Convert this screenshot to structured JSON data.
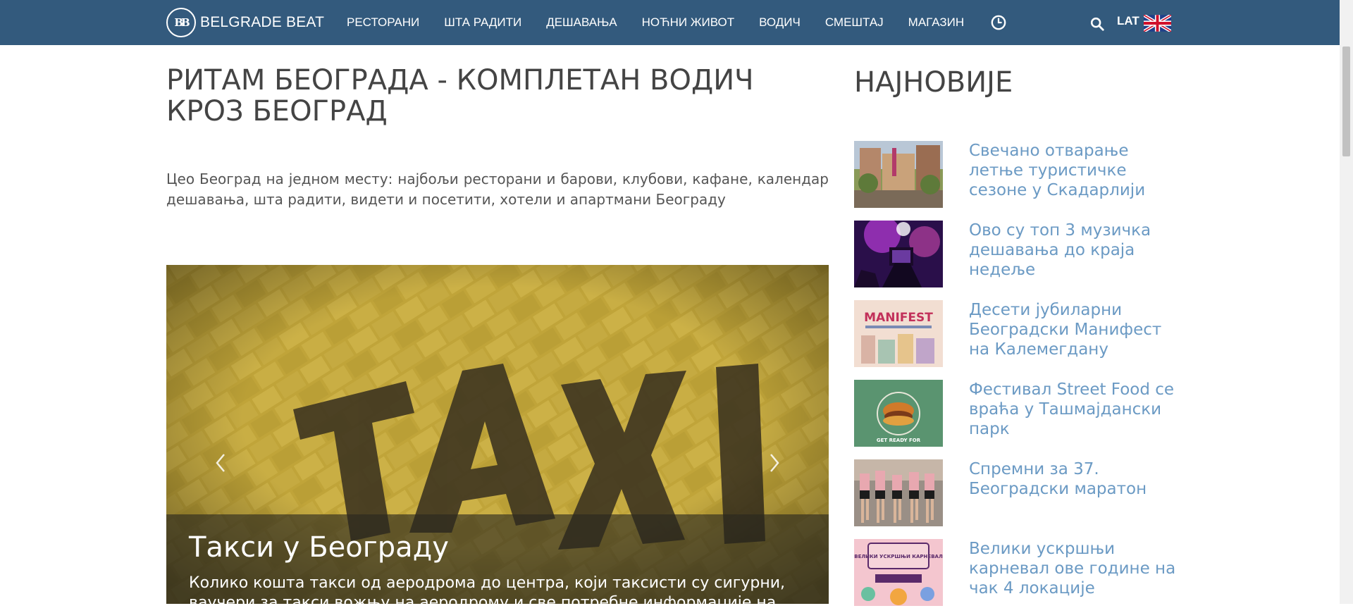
{
  "nav": {
    "brand": "BELGRADE BEAT",
    "brand_logo": "BB",
    "items": [
      {
        "label": "РЕСТОРАНИ"
      },
      {
        "label": "ШТА РАДИТИ"
      },
      {
        "label": "ДЕШАВАЊА"
      },
      {
        "label": "НОЋНИ ЖИВОТ"
      },
      {
        "label": "ВОДИЧ"
      },
      {
        "label": "СМЕШТАЈ"
      },
      {
        "label": "МАГАЗИН"
      }
    ],
    "clock_icon": "clock-icon",
    "search_icon": "search-icon",
    "lang_label": "LAT",
    "flag_icon": "uk-flag-icon",
    "colors": {
      "bar": "#335a7d",
      "text": "#ffffff"
    }
  },
  "main": {
    "title": "РИТАМ БЕОГРАДА - КОМПЛЕТАН ВОДИЧ КРОЗ БЕОГРАД",
    "intro": "Цео Београд на једном месту: најбољи ресторани и барови, клубови, кафане, календар дешавања, шта радити, видети и посетити, хотели и апартмани Београду",
    "slider": {
      "image_text": "TAXI",
      "caption_title": "Такси у Београду",
      "caption_text": "Колико кошта такси од аеродрома до центра, који таксисти су сигурни, ваучери за такси вожњу на аеродрому и све потребне информације на",
      "prev_icon": "chevron-left-icon",
      "next_icon": "chevron-right-icon"
    }
  },
  "sidebar": {
    "title": "НАЈНОВИЈЕ",
    "link_color": "#6b9ac4",
    "items": [
      {
        "title": "Свечано отварање летње туристичке сезоне у Скадарлији",
        "thumb": "street-photo"
      },
      {
        "title": "Ово су топ 3 музичка дешавања до краја недеље",
        "thumb": "concert-photo"
      },
      {
        "title": "Десети јубиларни Београдски Манифест на Калемегдану",
        "thumb": "manifest-poster",
        "thumb_text": "MANIFEST"
      },
      {
        "title": "Фестивал Street Food се враћа у Ташмајдански парк",
        "thumb": "street-food-poster",
        "thumb_text": "GET READY FOR"
      },
      {
        "title": "Спремни за 37. Београдски маратон",
        "thumb": "marathon-photo"
      },
      {
        "title": "Велики ускршњи карневал ове године на чак 4 локације",
        "thumb": "carnival-poster",
        "thumb_text": "ВЕЛИКИ УСКРШЊИ КАРНЕВАЛ"
      }
    ]
  }
}
